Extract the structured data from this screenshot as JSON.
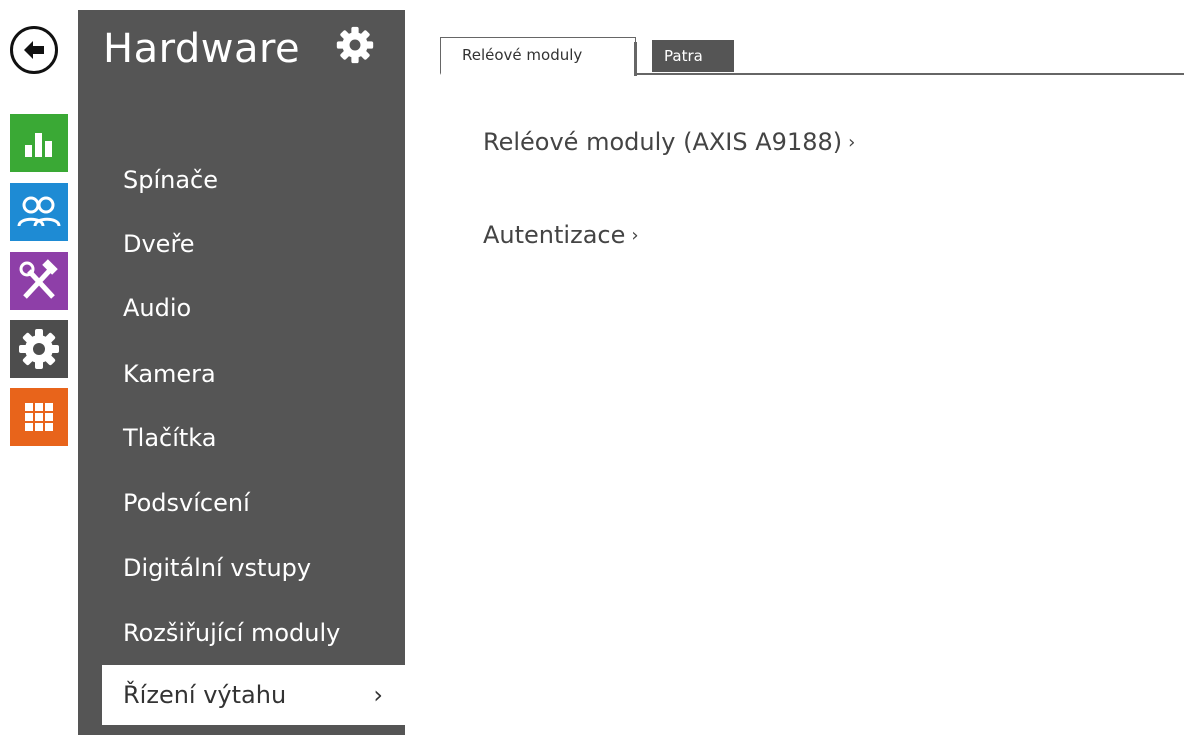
{
  "menu": {
    "title": "Hardware",
    "items": [
      {
        "label": "Spínače"
      },
      {
        "label": "Dveře"
      },
      {
        "label": "Audio"
      },
      {
        "label": "Kamera"
      },
      {
        "label": "Tlačítka"
      },
      {
        "label": "Podsvícení"
      },
      {
        "label": "Digitální vstupy"
      },
      {
        "label": "Rozšiřující moduly"
      },
      {
        "label": "Řízení výtahu",
        "active": true,
        "chevron": "›"
      }
    ]
  },
  "rail": {
    "back_icon": "arrow-left-icon",
    "items": [
      {
        "icon": "status-chart-icon",
        "color": "#3aa935"
      },
      {
        "icon": "users-icon",
        "color": "#1e8bd4"
      },
      {
        "icon": "tools-icon",
        "color": "#8e3fa8"
      },
      {
        "icon": "settings-gear-icon",
        "color": "#4d4d4d"
      },
      {
        "icon": "keypad-grid-icon",
        "color": "#e8641b"
      }
    ]
  },
  "tabs": [
    {
      "label": "Reléové moduly",
      "active": true
    },
    {
      "label": "Patra",
      "active": false
    }
  ],
  "content": {
    "links": [
      {
        "label": "Reléové moduly (AXIS A9188)",
        "chevron": "›"
      },
      {
        "label": "Autentizace",
        "chevron": "›"
      }
    ]
  },
  "colors": {
    "panel": "#555555",
    "text_dark": "#444444",
    "accent_green": "#3aa935",
    "accent_blue": "#1e8bd4",
    "accent_purple": "#8e3fa8",
    "accent_orange": "#e8641b"
  }
}
